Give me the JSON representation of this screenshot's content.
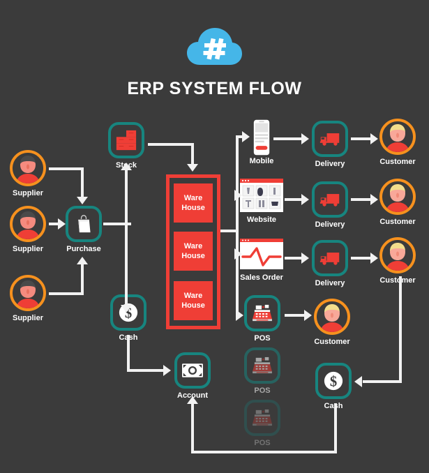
{
  "header": {
    "logo_icon": "cloud-hash-icon",
    "logo_color": "#45b6e8",
    "title": "ERP SYSTEM FLOW"
  },
  "theme": {
    "background": "#3b3b3b",
    "accent_teal": "#17857f",
    "accent_orange": "#f6911e",
    "accent_red": "#ef3e36",
    "line": "#f2f2f2",
    "text": "#ffffff"
  },
  "nodes": {
    "suppliers": [
      {
        "label": "Supplier",
        "icon": "supplier-avatar-icon"
      },
      {
        "label": "Supplier",
        "icon": "supplier-avatar-icon"
      },
      {
        "label": "Supplier",
        "icon": "supplier-avatar-icon"
      }
    ],
    "purchase": {
      "label": "Purchase",
      "icon": "shopping-bag-icon"
    },
    "stock": {
      "label": "Stock",
      "icon": "stock-boxes-icon"
    },
    "cash_left": {
      "label": "Cash",
      "icon": "dollar-coin-icon"
    },
    "account": {
      "label": "Account",
      "icon": "banknote-icon"
    },
    "warehouses": [
      {
        "line1": "Ware",
        "line2": "House"
      },
      {
        "line1": "Ware",
        "line2": "House"
      },
      {
        "line1": "Ware",
        "line2": "House"
      }
    ],
    "channels": [
      {
        "label": "Mobile",
        "icon": "mobile-phone-icon"
      },
      {
        "label": "Website",
        "icon": "website-browser-icon"
      },
      {
        "label": "Sales Order",
        "icon": "sales-chart-icon"
      }
    ],
    "deliveries": [
      {
        "label": "Delivery",
        "icon": "delivery-truck-icon"
      },
      {
        "label": "Delivery",
        "icon": "delivery-truck-icon"
      },
      {
        "label": "Delivery",
        "icon": "delivery-truck-icon"
      }
    ],
    "customers": [
      {
        "label": "Customer",
        "icon": "customer-avatar-icon"
      },
      {
        "label": "Customer",
        "icon": "customer-avatar-icon"
      },
      {
        "label": "Customer",
        "icon": "customer-avatar-icon"
      },
      {
        "label": "Customer",
        "icon": "customer-avatar-icon"
      }
    ],
    "pos": [
      {
        "label": "POS",
        "icon": "cash-register-icon"
      },
      {
        "label": "POS",
        "icon": "cash-register-icon"
      },
      {
        "label": "POS",
        "icon": "cash-register-icon"
      }
    ],
    "cash_right": {
      "label": "Cash",
      "icon": "dollar-coin-icon"
    }
  }
}
